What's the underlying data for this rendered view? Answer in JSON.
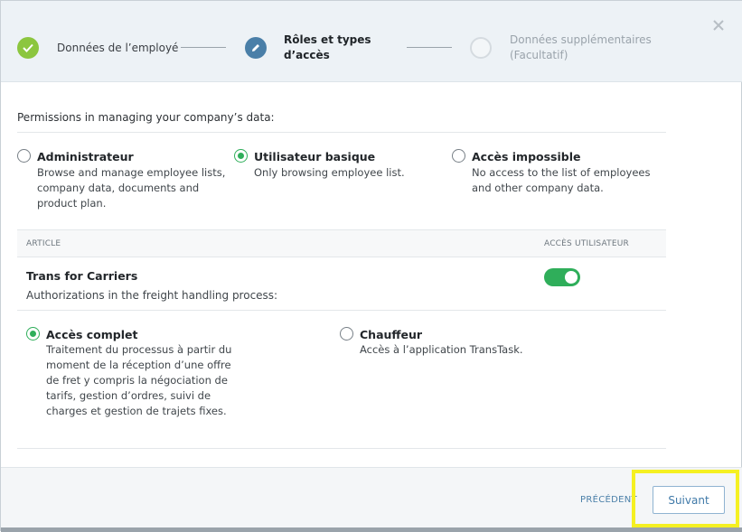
{
  "stepper": {
    "steps": [
      {
        "label": "Données de l’employé",
        "state": "done"
      },
      {
        "label": "Rôles et types d’accès",
        "state": "active"
      },
      {
        "label": "Données supplémentaires (Facultatif)",
        "state": "future"
      }
    ]
  },
  "permissions": {
    "intro": "Permissions in managing your company’s data:",
    "options": [
      {
        "title": "Administrateur",
        "desc": "Browse and manage employee lists, company data, documents and product plan.",
        "selected": false
      },
      {
        "title": "Utilisateur basique",
        "desc": "Only browsing employee list.",
        "selected": true
      },
      {
        "title": "Accès impossible",
        "desc": "No access to the list of employees and other company data.",
        "selected": false
      }
    ]
  },
  "table": {
    "col_article": "ARTICLE",
    "col_access": "ACCÈS UTILISATEUR"
  },
  "article": {
    "title": "Trans for Carriers",
    "desc": "Authorizations in the freight handling process:",
    "toggle_on": true,
    "options": [
      {
        "title": "Accès complet",
        "desc": "Traitement du processus à partir du moment de la réception d’une offre de fret y compris la négociation de tarifs, gestion d’ordres, suivi de charges et gestion de trajets fixes.",
        "selected": true
      },
      {
        "title": "Chauffeur",
        "desc": "Accès à l’application TransTask.",
        "selected": false
      }
    ]
  },
  "footer": {
    "prev_label": "PRÉCÉDENT",
    "next_label": "Suivant"
  },
  "colors": {
    "accent_green": "#2fae5a",
    "step_done": "#8cc63f",
    "step_active": "#4a7fa8",
    "highlight": "#f5f022"
  }
}
